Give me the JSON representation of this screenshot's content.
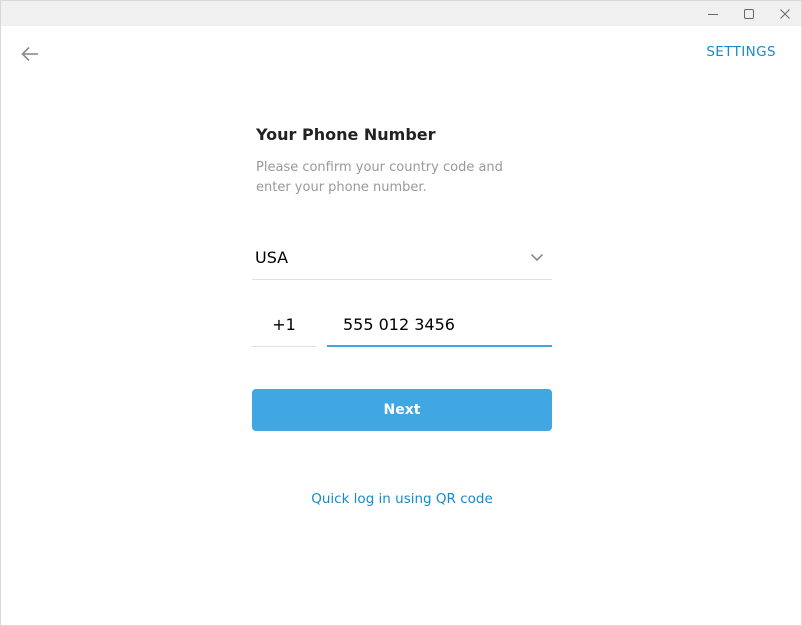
{
  "window": {
    "controls": [
      "minimize-icon",
      "maximize-icon",
      "close-icon"
    ]
  },
  "header": {
    "back_icon": "arrow-left-icon",
    "settings_label": "SETTINGS"
  },
  "login": {
    "title": "Your Phone Number",
    "description": "Please confirm your country code and enter your phone number.",
    "country": {
      "value": "USA",
      "icon": "chevron-down-icon"
    },
    "country_code": "+1",
    "phone_number": "555 012 3456",
    "next_label": "Next",
    "qr_link": "Quick log in using QR code"
  },
  "colors": {
    "accent": "#40a7e3",
    "link": "#168acd",
    "title_text": "#222222",
    "muted_text": "#999999"
  }
}
